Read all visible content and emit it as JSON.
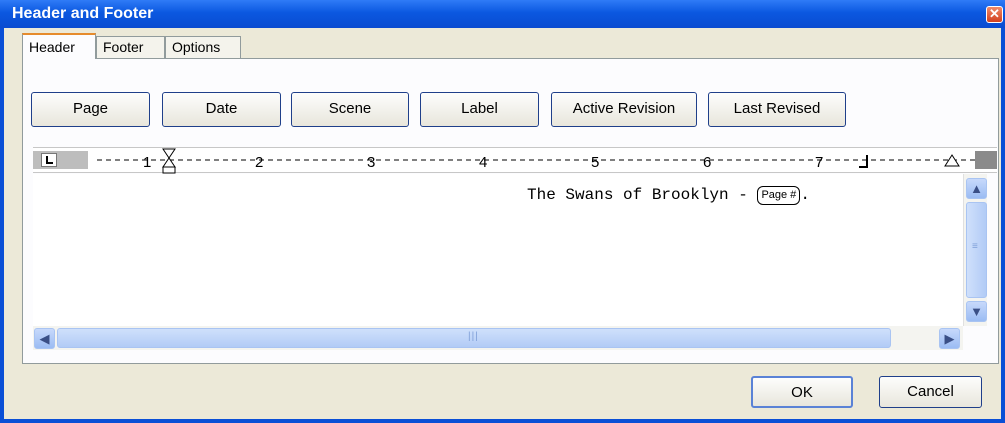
{
  "window": {
    "title": "Header and Footer"
  },
  "tabs": [
    {
      "label": "Header",
      "selected": true
    },
    {
      "label": "Footer",
      "selected": false
    },
    {
      "label": "Options",
      "selected": false
    }
  ],
  "insert_buttons": [
    {
      "label": "Page"
    },
    {
      "label": "Date"
    },
    {
      "label": "Scene"
    },
    {
      "label": "Label"
    },
    {
      "label": "Active Revision"
    },
    {
      "label": "Last Revised"
    }
  ],
  "ruler": {
    "numbers": [
      "1",
      "2",
      "3",
      "4",
      "5",
      "6",
      "7"
    ]
  },
  "editor": {
    "header_text": "The Swans of Brooklyn - ",
    "field_chip": "Page #",
    "trailing_text": "."
  },
  "dialog_buttons": {
    "ok_label": "OK",
    "cancel_label": "Cancel"
  },
  "icons": {
    "close": "close-icon",
    "scroll_up": "chevron-up-icon",
    "scroll_down": "chevron-down-icon",
    "scroll_left": "chevron-left-icon",
    "scroll_right": "chevron-right-icon"
  }
}
